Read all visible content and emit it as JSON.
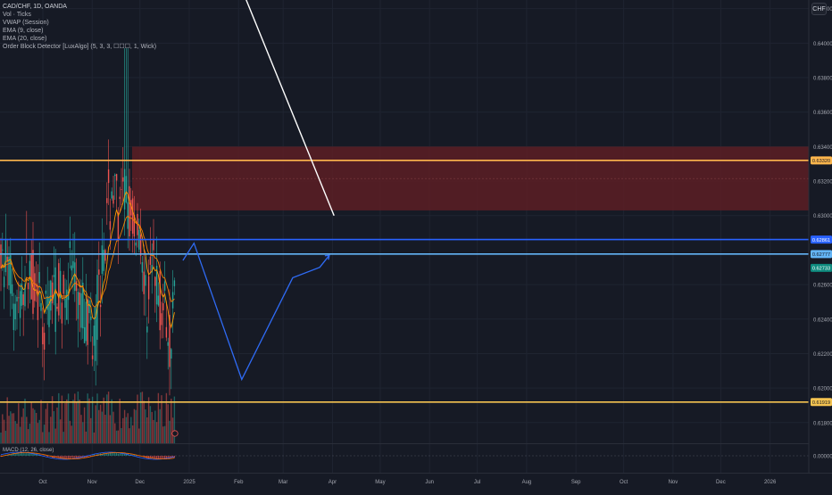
{
  "legend": {
    "symbol": "CAD/CHF, 1D, OANDA",
    "lines": [
      "Vol · Ticks",
      "VWAP (Session)",
      "EMA (9, close)",
      "EMA (20, close)",
      "Order Block Detector [LuxAlgo] (5, 3, 3, ☐☐☐, 1, Wick)"
    ]
  },
  "currency_button": "CHF",
  "colors": {
    "background": "#161a25",
    "up": "#26a69a",
    "down": "#ef5350",
    "ema9": "#ff9800",
    "ema20": "#f57c00",
    "order_block_fill": "#5c1f24",
    "orange_level": "#ffb74d",
    "yellow_level": "#f5c451",
    "blue_level": "#2962ff",
    "light_blue_level": "#64b5f6",
    "projection": "#2f6bf5",
    "trendline": "#ffffff"
  },
  "chart_data": {
    "type": "candlestick",
    "instrument": "CAD/CHF",
    "timeframe": "1D",
    "ylim": [
      0.6168,
      0.6425
    ],
    "y_ticks": [
      "0.64200",
      "0.64000",
      "0.63800",
      "0.63600",
      "0.63400",
      "0.63200",
      "0.63000",
      "0.62600",
      "0.62400",
      "0.62200",
      "0.62000",
      "0.61800"
    ],
    "x_ticks": [
      "Oct",
      "Nov",
      "Dec",
      "2025",
      "Feb",
      "Mar",
      "Apr",
      "May",
      "Jun",
      "Jul",
      "Aug",
      "Sep",
      "Oct",
      "Nov",
      "Dec",
      "2026"
    ],
    "horizontal_levels": [
      {
        "value": 0.6332,
        "label": "0.63320",
        "style": "orange"
      },
      {
        "value": 0.62861,
        "label": "0.62861",
        "style": "blue"
      },
      {
        "value": 0.62777,
        "label": "0.62777",
        "style": "light-blue"
      },
      {
        "value": 0.61919,
        "label": "0.61919",
        "style": "yellow"
      }
    ],
    "last_price": {
      "value": 0.62733,
      "label": "0.62733"
    },
    "order_block_zone": {
      "top": 0.634,
      "bottom": 0.6303
    },
    "projection_path": [
      {
        "date": "2024-12-28",
        "price": 0.6274
      },
      {
        "date": "2025-01-04",
        "price": 0.6284
      },
      {
        "date": "2025-02-03",
        "price": 0.6205
      },
      {
        "date": "2025-03-07",
        "price": 0.6264
      },
      {
        "date": "2025-03-24",
        "price": 0.627
      },
      {
        "date": "2025-03-30",
        "price": 0.6277
      }
    ],
    "trendline": [
      {
        "date": "2025-01-28",
        "price": 0.6445
      },
      {
        "date": "2025-04-02",
        "price": 0.63
      }
    ],
    "macd": {
      "label": "MACD (12, 26, close)",
      "zero_label": "0.00000"
    }
  }
}
